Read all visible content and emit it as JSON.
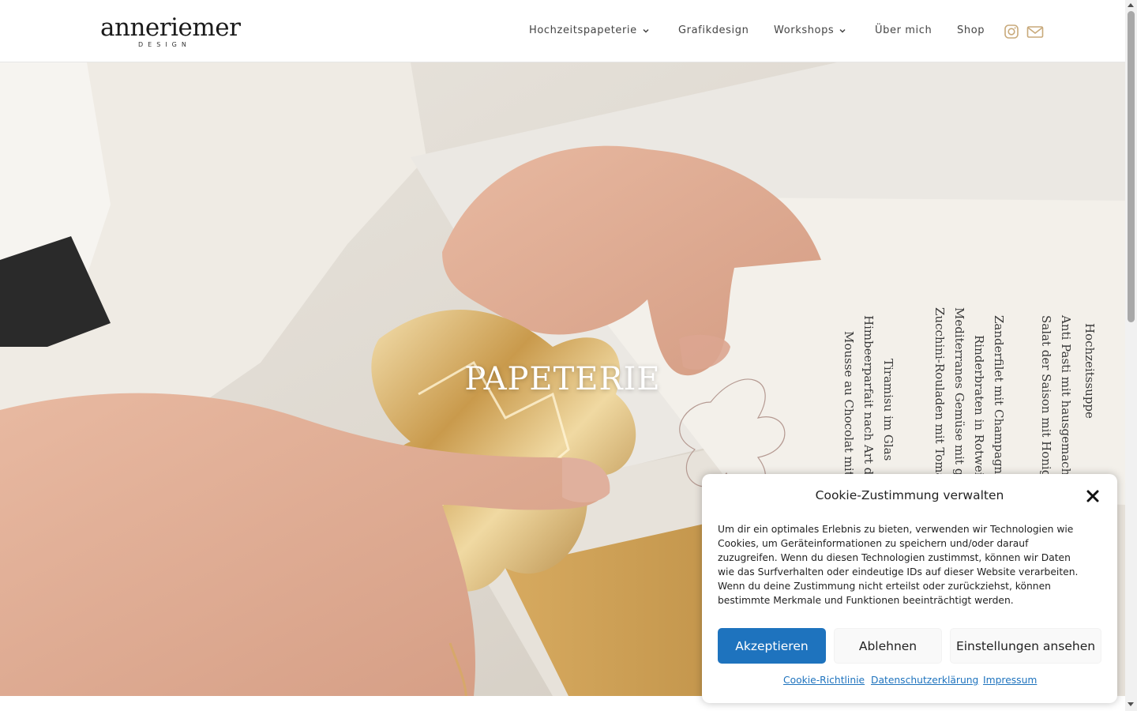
{
  "header": {
    "logo_text": "anneriemer",
    "logo_subtext": "DESIGN",
    "nav": [
      {
        "label": "Hochzeitspapeterie",
        "has_dropdown": true
      },
      {
        "label": "Grafikdesign",
        "has_dropdown": false
      },
      {
        "label": "Workshops",
        "has_dropdown": true
      },
      {
        "label": "Über mich",
        "has_dropdown": false
      },
      {
        "label": "Shop",
        "has_dropdown": false
      }
    ],
    "icons": [
      "instagram-icon",
      "mail-icon"
    ],
    "accent_color": "#c8a97a"
  },
  "hero": {
    "title": "PAPETERIE",
    "menu_card_lines": [
      "Hochzeitssuppe",
      "Anti Pasti mit hausgemachtem Baguette",
      "Salat der Saison mit Honig-Senf-Dressing",
      "Zanderfilet mit Champagnerschaumsauce",
      "Rinderbraten in Rotwein-Sauce",
      "Mediterranes Gemüse mit gegrillten Scampi",
      "Zucchini-Rouladen mit Tomaten und Käse",
      "Tiramisu im Glas",
      "Himbeerparfait nach Art des Hauses",
      "Mousse au Chocolat mit Rum"
    ]
  },
  "cookie_banner": {
    "title": "Cookie-Zustimmung verwalten",
    "text": "Um dir ein optimales Erlebnis zu bieten, verwenden wir Technologien wie Cookies, um Geräteinformationen zu speichern und/oder darauf zuzugreifen. Wenn du diesen Technologien zustimmst, können wir Daten wie das Surfverhalten oder eindeutige IDs auf dieser Website verarbeiten. Wenn du deine Zustimmung nicht erteilst oder zurückziehst, können bestimmte Merkmale und Funktionen beeinträchtigt werden.",
    "buttons": {
      "accept": "Akzeptieren",
      "deny": "Ablehnen",
      "preferences": "Einstellungen ansehen"
    },
    "links": [
      "Cookie-Richtlinie",
      "Datenschutzerklärung",
      "Impressum"
    ],
    "accept_color": "#1e73be"
  }
}
